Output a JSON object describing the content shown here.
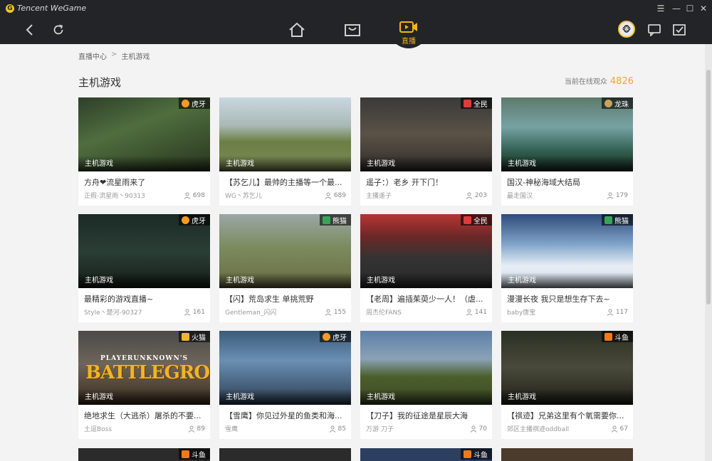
{
  "app": {
    "brand": "Tencent WeGame"
  },
  "window": {
    "menu": "☰",
    "minimize": "—",
    "maximize": "☐",
    "close": "✕"
  },
  "toolbar": {
    "active_tab_label": "直播"
  },
  "breadcrumb": {
    "root": "直播中心",
    "separator": ">",
    "current": "主机游戏"
  },
  "section": {
    "title": "主机游戏",
    "viewers_label": "当前在线观众",
    "viewers_count": "4826"
  },
  "colors": {
    "accent": "#f5b318",
    "huya": "#f59a23",
    "quanmin": "#e03a3a",
    "longzhu": "#c9a25a",
    "panda": "#3aa35b",
    "huomao": "#f0b429",
    "douyu": "#f07a1a"
  },
  "cards": [
    {
      "category": "主机游戏",
      "platform": "虎牙",
      "platform_icon": "huya",
      "title": "方舟❤流星雨来了",
      "streamer": "正假-流星雨丶90313",
      "viewers": "698"
    },
    {
      "category": "主机游戏",
      "platform": "",
      "platform_icon": "",
      "title": "【苏乞儿】最帅的主播等一个最...",
      "streamer": "WG丶苏乞儿",
      "viewers": "689"
    },
    {
      "category": "主机游戏",
      "platform": "全民",
      "platform_icon": "quanmin",
      "title": "遥子：）老乡 开下门！",
      "streamer": "主播遥子",
      "viewers": "203"
    },
    {
      "category": "主机游戏",
      "platform": "龙珠",
      "platform_icon": "longzhu",
      "title": "国汉-神秘海域大结局",
      "streamer": "最走国汉",
      "viewers": "179"
    },
    {
      "category": "主机游戏",
      "platform": "虎牙",
      "platform_icon": "huya",
      "title": "最精彩的游戏直播~",
      "streamer": "Style丶楚河-90327",
      "viewers": "161"
    },
    {
      "category": "主机游戏",
      "platform": "熊猫",
      "platform_icon": "panda",
      "title": "【闪】荒岛求生 单挑荒野",
      "streamer": "Gentleman_闪闪",
      "viewers": "155"
    },
    {
      "category": "主机游戏",
      "platform": "全民",
      "platform_icon": "quanmin",
      "title": "【老周】遍插茱萸少一人！（虐...",
      "streamer": "周杰伦FANS",
      "viewers": "141"
    },
    {
      "category": "主机游戏",
      "platform": "熊猫",
      "platform_icon": "panda",
      "title": "漫漫长夜 我只是想生存下去~",
      "streamer": "baby唐宝",
      "viewers": "117"
    },
    {
      "category": "主机游戏",
      "platform": "火猫",
      "platform_icon": "huomao",
      "title": "绝地求生（大逃杀）屠杀的不要...",
      "streamer": "土逗Boss",
      "viewers": "89",
      "overlay_small": "PLAYERUNKNOWN'S",
      "overlay_big": "BATTLEGROUNDS"
    },
    {
      "category": "主机游戏",
      "platform": "虎牙",
      "platform_icon": "huya",
      "title": "【雪鹰】你见过外星的鱼类和海...",
      "streamer": "雪鹰",
      "viewers": "85"
    },
    {
      "category": "主机游戏",
      "platform": "",
      "platform_icon": "",
      "title": "【刀子】我的征途是星辰大海",
      "streamer": "万游 刀子",
      "viewers": "70"
    },
    {
      "category": "主机游戏",
      "platform": "斗鱼",
      "platform_icon": "douyu",
      "title": "【祺迹】兄弟这里有个氧需要你...",
      "streamer": "郊区主播祺迹oddball",
      "viewers": "67"
    }
  ],
  "partial_row": [
    {
      "platform": "斗鱼"
    },
    {
      "platform": ""
    },
    {
      "platform": "斗鱼"
    },
    {
      "platform": ""
    }
  ]
}
